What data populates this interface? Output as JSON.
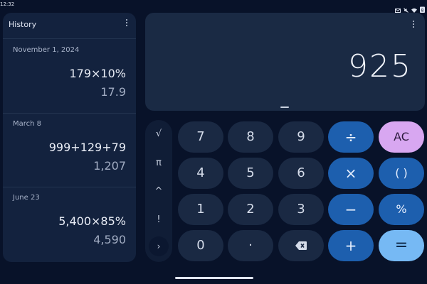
{
  "status": {
    "time": "12:32",
    "battery": "8"
  },
  "history": {
    "title": "History",
    "entries": [
      {
        "date": "November 1, 2024",
        "expression": "179×10%",
        "result": "17.9"
      },
      {
        "date": "March 8",
        "expression": "999+129+79",
        "result": "1,207"
      },
      {
        "date": "June 23",
        "expression": "5,400×85%",
        "result": "4,590"
      }
    ]
  },
  "display": {
    "value": "925"
  },
  "scientific": {
    "sqrt": "√",
    "pi": "π",
    "power": "^",
    "factorial": "!",
    "expand": "›"
  },
  "keypad": {
    "seven": "7",
    "eight": "8",
    "nine": "9",
    "four": "4",
    "five": "5",
    "six": "6",
    "one": "1",
    "two": "2",
    "three": "3",
    "zero": "0",
    "decimal": "·",
    "divide": "÷",
    "multiply": "×",
    "subtract": "−",
    "add": "+",
    "clear": "AC",
    "parentheses": "( )",
    "percent": "%",
    "equals": "="
  },
  "colors": {
    "background": "#081229",
    "panel": "#13223e",
    "number_key": "#1a2943",
    "operator_key": "#1d5fae",
    "clear_key": "#d8a7f1",
    "equals_key": "#76b9f4"
  }
}
